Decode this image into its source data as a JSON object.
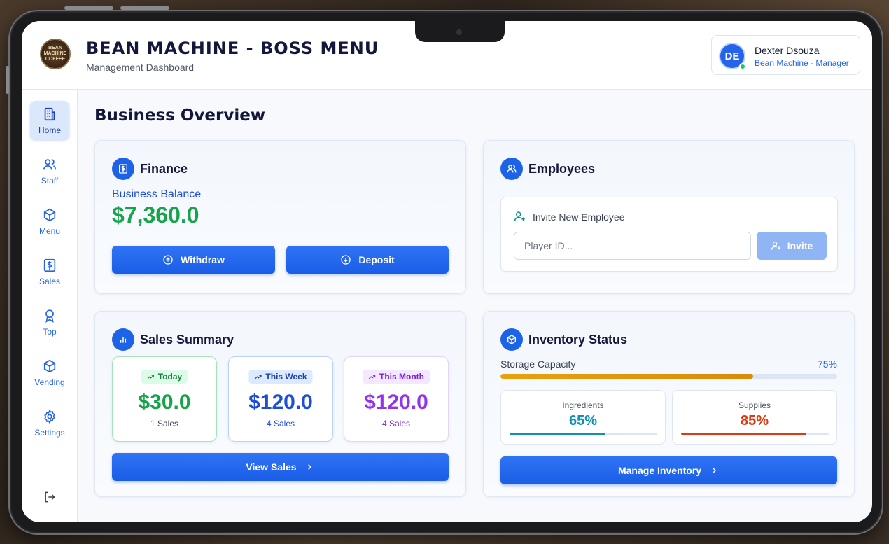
{
  "header": {
    "logo_text": "BEAN MACHINE COFFEE",
    "title": "BEAN MACHINE - BOSS MENU",
    "subtitle": "Management Dashboard"
  },
  "user": {
    "initials": "DE",
    "name": "Dexter Dsouza",
    "role": "Bean Machine - Manager",
    "status_color": "#22c55e"
  },
  "sidebar": {
    "items": [
      {
        "label": "Home",
        "icon": "building-icon",
        "active": true
      },
      {
        "label": "Staff",
        "icon": "users-icon"
      },
      {
        "label": "Menu",
        "icon": "box-icon"
      },
      {
        "label": "Sales",
        "icon": "dollar-icon"
      },
      {
        "label": "Top",
        "icon": "award-icon"
      },
      {
        "label": "Vending",
        "icon": "box-icon"
      },
      {
        "label": "Settings",
        "icon": "gear-icon"
      }
    ],
    "logout_icon": "logout-icon"
  },
  "main": {
    "title": "Business Overview"
  },
  "finance": {
    "title": "Finance",
    "balance_label": "Business Balance",
    "balance_value": "$7,360.0",
    "withdraw_label": "Withdraw",
    "deposit_label": "Deposit"
  },
  "employees": {
    "title": "Employees",
    "invite_label": "Invite New Employee",
    "input_placeholder": "Player ID...",
    "invite_button": "Invite"
  },
  "sales": {
    "title": "Sales Summary",
    "periods": [
      {
        "badge": "Today",
        "value": "$30.0",
        "count": "1 Sales",
        "color": "#16a34a",
        "badge_bg": "#dcfce7"
      },
      {
        "badge": "This Week",
        "value": "$120.0",
        "count": "4 Sales",
        "color": "#1d4ed8",
        "badge_bg": "#dbeafe"
      },
      {
        "badge": "This Month",
        "value": "$120.0",
        "count": "4 Sales",
        "color": "#9333ea",
        "badge_bg": "#f3e8ff"
      }
    ],
    "view_button": "View Sales"
  },
  "inventory": {
    "title": "Inventory Status",
    "storage_label": "Storage Capacity",
    "storage_pct": "75%",
    "storage_value": 0.75,
    "ingredients_label": "Ingredients",
    "ingredients_pct": "65%",
    "ingredients_value": 0.65,
    "supplies_label": "Supplies",
    "supplies_pct": "85%",
    "supplies_value": 0.85,
    "manage_button": "Manage Inventory"
  },
  "colors": {
    "accent": "#1d63e8",
    "storage_bar": "#e39a0b",
    "ingredients": "#0e8fb5",
    "supplies": "#dc3a12"
  }
}
